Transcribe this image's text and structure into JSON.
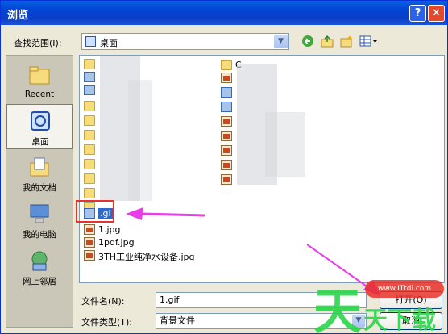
{
  "window": {
    "title": "浏览",
    "help_glyph": "?",
    "close_glyph": "✕"
  },
  "toolbar": {
    "lookin_label": "查找范围(I):",
    "location": "桌面",
    "dropdown_glyph": "▼",
    "icons": [
      "back-icon",
      "up-folder-icon",
      "new-folder-icon",
      "view-menu-icon"
    ]
  },
  "places": [
    {
      "name": "recent",
      "label": "Recent",
      "icon": "recent-folder-icon"
    },
    {
      "name": "desktop",
      "label": "桌面",
      "icon": "desktop-icon",
      "selected": true
    },
    {
      "name": "my-documents",
      "label": "我的文档",
      "icon": "documents-icon"
    },
    {
      "name": "my-computer",
      "label": "我的电脑",
      "icon": "computer-icon"
    },
    {
      "name": "network",
      "label": "网上邻居",
      "icon": "network-icon"
    }
  ],
  "files": {
    "right_column_first": "C",
    "highlighted_file": ".gi",
    "items": [
      "1.jpg",
      "1pdf.jpg",
      "3TH工业纯净水设备.jpg"
    ]
  },
  "form": {
    "filename_label": "文件名(N):",
    "filename_value": "1.gif",
    "filetype_label": "文件类型(T):",
    "filetype_value": "背景文件",
    "open_button": "打开(O)",
    "cancel_button": "取消"
  },
  "watermark": {
    "badge_text": "www.ITtdl.com",
    "logo_text": "天天下载"
  },
  "colors": {
    "title_bar": "#0a4fd8",
    "highlight_box": "#e8322b",
    "annotation_arrow": "#e83de8",
    "watermark_green": "#2bd64b"
  }
}
